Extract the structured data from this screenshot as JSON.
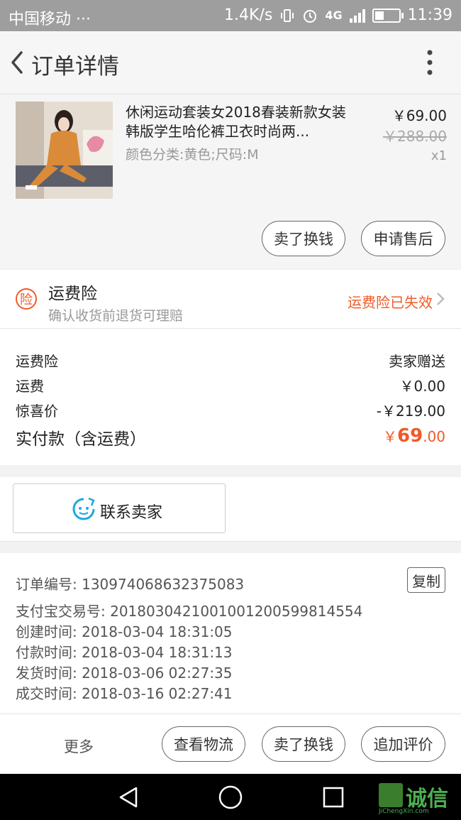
{
  "status_bar": {
    "carrier": "中国移动 ···",
    "speed": "1.4K/s",
    "network": "4G",
    "time": "11:39"
  },
  "header": {
    "title": "订单详情"
  },
  "product": {
    "name": "休闲运动套装女2018春装新款女装韩版学生哈伦裤卫衣时尚两...",
    "sku": "颜色分类:黄色;尺码:M",
    "price": "￥69.00",
    "original_price": "￥288.00",
    "quantity": "x1",
    "actions": [
      "卖了换钱",
      "申请售后"
    ]
  },
  "insurance": {
    "icon_label": "险",
    "title": "运费险",
    "subtitle": "确认收货前退货可理赔",
    "status": "运费险已失效"
  },
  "fees": [
    {
      "label": "运费险",
      "value": "卖家赠送"
    },
    {
      "label": "运费",
      "value": "￥0.00"
    },
    {
      "label": "惊喜价",
      "value": "-￥219.00"
    }
  ],
  "total": {
    "label": "实付款（含运费）",
    "currency": "￥",
    "integer": "69",
    "decimal": ".00"
  },
  "contact": {
    "label": "联系卖家"
  },
  "order_info": {
    "copy_label": "复制",
    "rows": [
      "订单编号: 1309740686323750​83",
      "支付宝交易号: 2018030421001001200599814554",
      "创建时间: 2018-03-04 18:31:05",
      "付款时间: 2018-03-04 18:31:13",
      "发货时间: 2018-03-06 02:27:35",
      "成交时间: 2018-03-16 02:27:41"
    ]
  },
  "bottom_bar": {
    "more": "更多",
    "actions": [
      "查看物流",
      "卖了换钱",
      "追加评价"
    ]
  },
  "watermark": {
    "text": "诚信",
    "sub": "JiChengXin.com"
  },
  "colors": {
    "accent": "#f05a28",
    "status_bar": "#9e9e9e",
    "contact_icon": "#1ea7e1"
  }
}
